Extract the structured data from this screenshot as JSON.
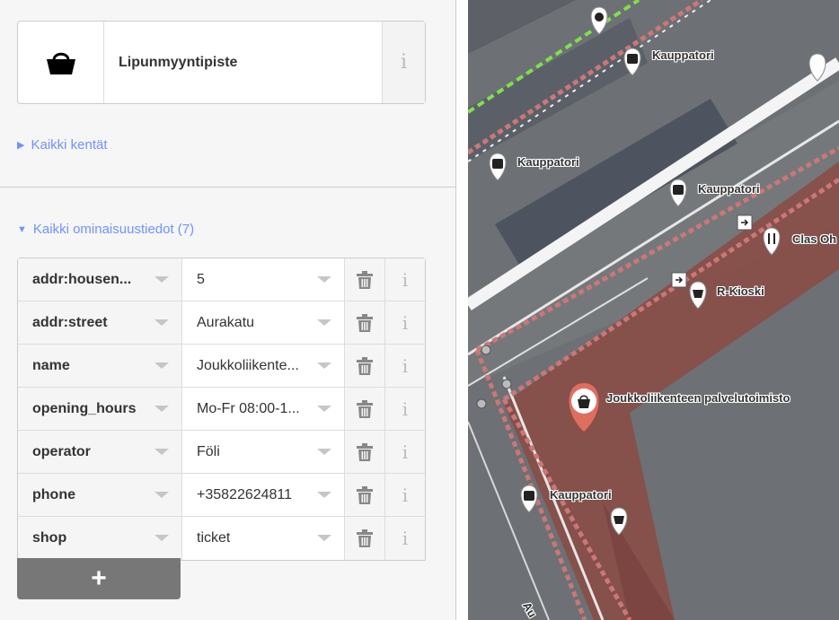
{
  "preset": {
    "name": "Lipunmyyntipiste",
    "icon": "basket-icon"
  },
  "sections": {
    "all_fields": "Kaikki kentät",
    "all_tags": "Kaikki ominaisuustiedot (7)"
  },
  "tags": [
    {
      "key": "addr:housen...",
      "value": "5"
    },
    {
      "key": "addr:street",
      "value": "Aurakatu"
    },
    {
      "key": "name",
      "value": "Joukkoliikente..."
    },
    {
      "key": "opening_hours",
      "value": "Mo-Fr 08:00-1..."
    },
    {
      "key": "operator",
      "value": "Föli"
    },
    {
      "key": "phone",
      "value": "+35822624811"
    },
    {
      "key": "shop",
      "value": "ticket"
    }
  ],
  "add_label": "+",
  "info_glyph": "i",
  "map": {
    "labels": {
      "kauppatori_1": "Kauppatori",
      "kauppatori_2": "Kauppatori",
      "kauppatori_3": "Kauppatori",
      "kauppatori_4": "Kauppatori",
      "clas": "Clas Oh",
      "rkioski": "R-Kioski",
      "selected": "Joukkoliikenteen palvelutoimisto",
      "street": "Au"
    },
    "colors": {
      "selected_pin": "#e06e5f",
      "building": "#8b4a44",
      "path": "#f5f5f5"
    }
  }
}
